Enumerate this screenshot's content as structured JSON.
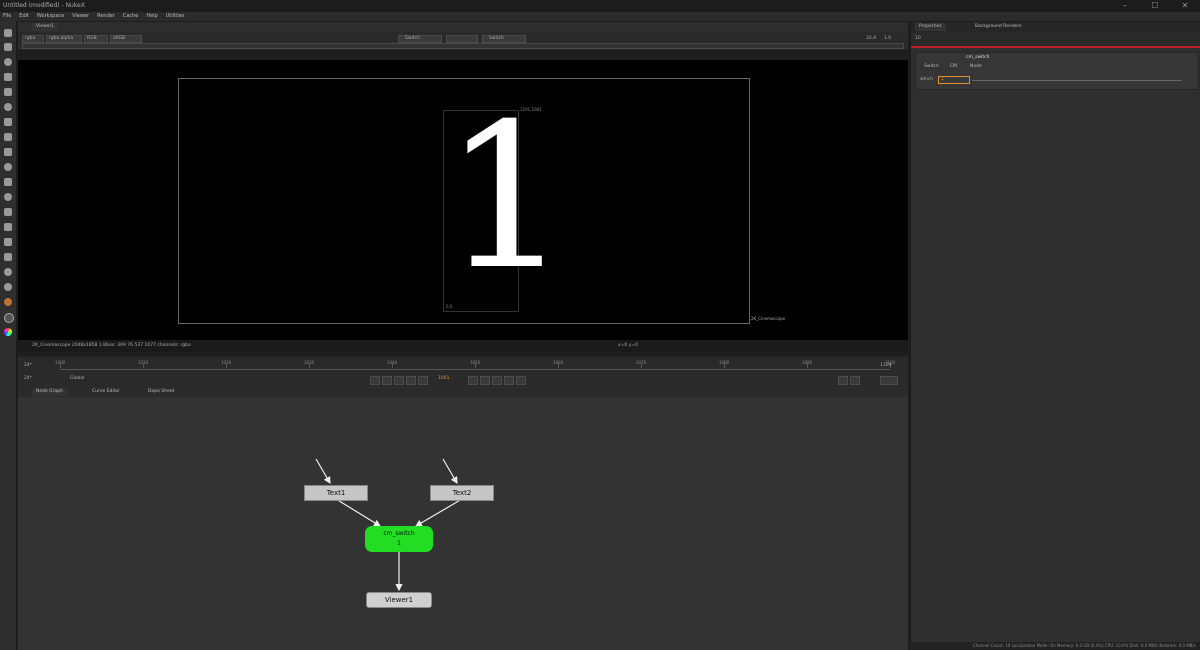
{
  "window": {
    "title": "Untitled (modified) - NukeX"
  },
  "menu": [
    "File",
    "Edit",
    "Workspace",
    "Viewer",
    "Render",
    "Cache",
    "Help",
    "Utilities"
  ],
  "viewer": {
    "tab": "Viewer1",
    "channels": "rgba",
    "alpha": "rgba.alpha",
    "colorspace": "RGB",
    "channel_mode": "sRGB",
    "input_a": "Switch",
    "input_b": "Switch",
    "zoom": "32.4",
    "gain": "1.0",
    "frame_counter": "1/1",
    "display_number": "1",
    "bbox_top_right": "1201,1081",
    "bbox_bottom_left": "0,0",
    "format_label": "2K_Cinemascope",
    "info_line": "2K_Cinemascope 2048x1858 1 Bbox: 369 76 537 1077 channels: rgba",
    "info_right": "x=0 y=0"
  },
  "timeline": {
    "fps": "24*",
    "global": "Global",
    "current_frame": "1001",
    "ticks": [
      "1000",
      "1010",
      "1020",
      "1030",
      "1040",
      "1050",
      "1060",
      "1070",
      "1080",
      "1090",
      "1100"
    ],
    "end_frame": "1100"
  },
  "node_graph": {
    "tabs": [
      "Node Graph",
      "Curve Editor",
      "Dope Sheet"
    ],
    "nodes": {
      "text1": "Text1",
      "text2": "Text2",
      "switch_name": "cm_switch",
      "switch_value": "1",
      "viewer": "Viewer1"
    }
  },
  "properties": {
    "tabs": [
      "Properties",
      "Background Renders"
    ],
    "count": "10",
    "node_name": "cm_switch",
    "subtabs": [
      "Switch",
      "CM",
      "Node"
    ],
    "which_label": "which",
    "which_value": "1"
  },
  "status": {
    "text": "Channel Count: 19 Localization Mode: On Memory: 6.0 GB (6.4%) CPU: 10.0% Disk: 0.0 MB/s Network: 0.0 MB/s"
  },
  "colors": {
    "switch_node": "#22dd22",
    "properties_accent": "#c0202a",
    "viewport_bg": "#000000"
  }
}
